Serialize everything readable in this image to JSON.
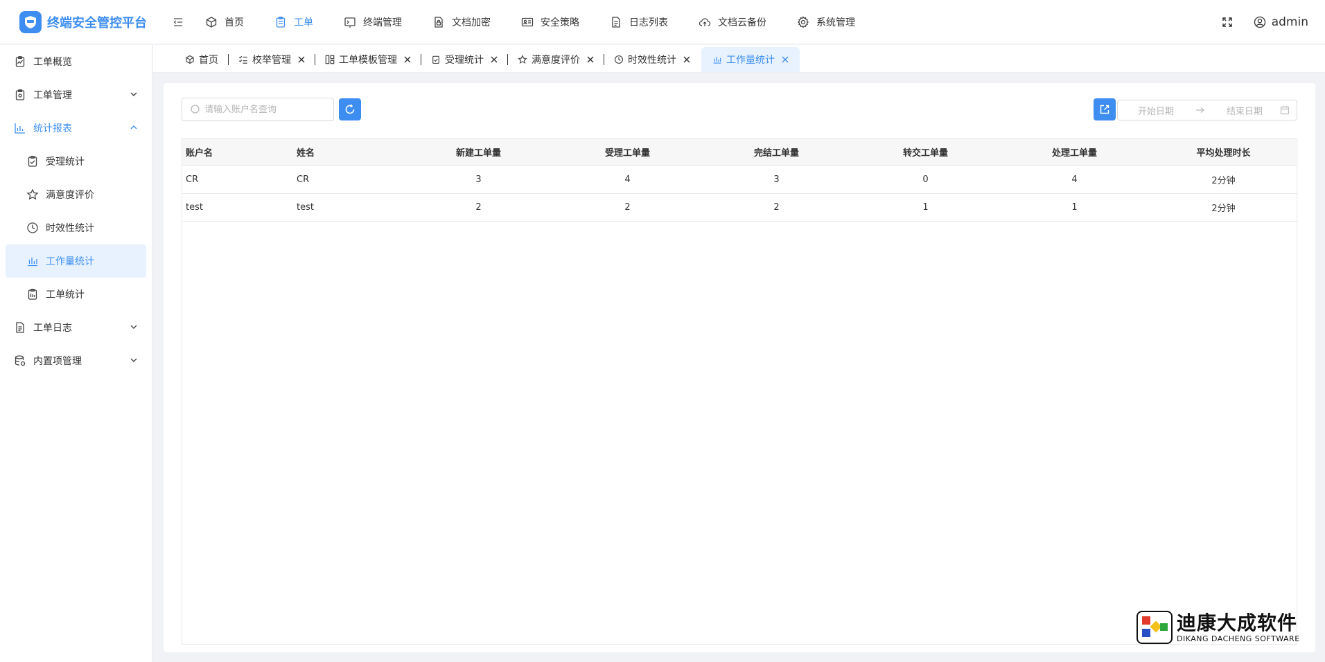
{
  "app": {
    "title": "终端安全管控平台"
  },
  "header": {
    "nav": [
      {
        "label": "首页",
        "icon": "cube-icon"
      },
      {
        "label": "工单",
        "icon": "clipboard-icon"
      },
      {
        "label": "终端管理",
        "icon": "terminal-icon"
      },
      {
        "label": "文档加密",
        "icon": "encrypted-file-icon"
      },
      {
        "label": "安全策略",
        "icon": "id-card-icon"
      },
      {
        "label": "日志列表",
        "icon": "log-file-icon"
      },
      {
        "label": "文档云备份",
        "icon": "cloud-upload-icon"
      },
      {
        "label": "系统管理",
        "icon": "gear-icon"
      }
    ],
    "active_nav": "工单",
    "user": "admin"
  },
  "sidebar": {
    "items": [
      {
        "label": "工单概览"
      },
      {
        "label": "工单管理"
      },
      {
        "label": "统计报表"
      },
      {
        "label": "工单日志"
      },
      {
        "label": "内置项管理"
      }
    ],
    "sub_items": [
      {
        "label": "受理统计"
      },
      {
        "label": "满意度评价"
      },
      {
        "label": "时效性统计"
      },
      {
        "label": "工作量统计"
      },
      {
        "label": "工单统计"
      }
    ],
    "active_sub": "工作量统计"
  },
  "tabs": [
    {
      "label": "首页"
    },
    {
      "label": "校举管理"
    },
    {
      "label": "工单模板管理"
    },
    {
      "label": "受理统计"
    },
    {
      "label": "满意度评价"
    },
    {
      "label": "时效性统计"
    },
    {
      "label": "工作量统计"
    }
  ],
  "toolbar": {
    "search_placeholder": "请输入账户名查询",
    "start_date_placeholder": "开始日期",
    "end_date_placeholder": "结束日期"
  },
  "table": {
    "columns": [
      "账户名",
      "姓名",
      "新建工单量",
      "受理工单量",
      "完结工单量",
      "转交工单量",
      "处理工单量",
      "平均处理时长"
    ],
    "rows": [
      [
        "CR",
        "CR",
        "3",
        "4",
        "3",
        "0",
        "4",
        "2分钟"
      ],
      [
        "test",
        "test",
        "2",
        "2",
        "2",
        "1",
        "1",
        "2分钟"
      ]
    ]
  },
  "watermark": {
    "cn": "迪康大成软件",
    "en": "DIKANG DACHENG SOFTWARE"
  },
  "colors": {
    "accent": "#3d8ef0",
    "active_bg": "#e8f2fe",
    "text": "#333333"
  }
}
